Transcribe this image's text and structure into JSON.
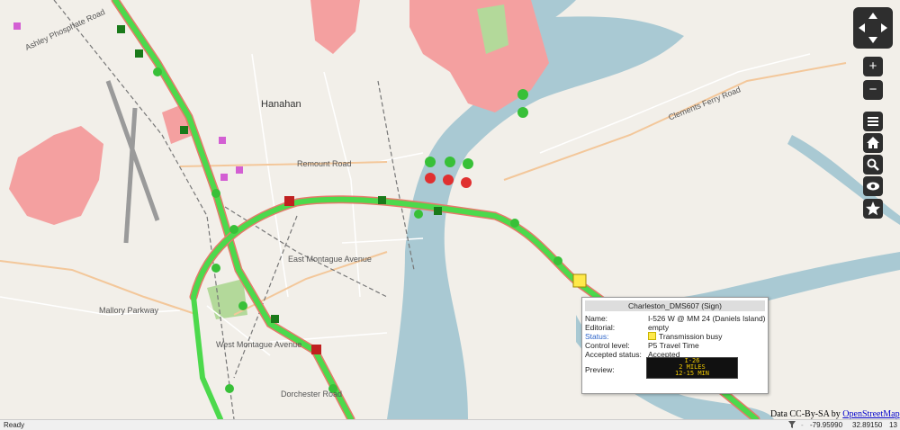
{
  "map": {
    "places": [
      {
        "id": "hanahan",
        "text": "Hanahan"
      },
      {
        "id": "remount",
        "text": "Remount Road"
      },
      {
        "id": "clements",
        "text": "Clements Ferry Road"
      },
      {
        "id": "montague",
        "text": "East Montague Avenue"
      },
      {
        "id": "westmontague",
        "text": "West Montague Avenue"
      },
      {
        "id": "dorchester",
        "text": "Dorchester Road"
      },
      {
        "id": "mallory",
        "text": "Mallory Parkway"
      },
      {
        "id": "ashley",
        "text": "Ashley Phosphate Road"
      }
    ],
    "colors": {
      "freeway": "#4cd94c",
      "incident": "#e03030",
      "zone": "#f4a0a0",
      "water": "#a9c9d3",
      "park": "#b3d99a"
    }
  },
  "controls": {
    "pan_icon": "pan-arrows-icon",
    "zoom_in": "+",
    "zoom_out": "−",
    "menu_icon": "menu-icon",
    "home_icon": "home-icon",
    "search_icon": "search-icon",
    "view_icon": "eye-icon",
    "favorite_icon": "star-icon"
  },
  "popup": {
    "title": "Charleston_DMS607 (Sign)",
    "name_label": "Name:",
    "name_value": "I-526 W @ MM 24 (Daniels Island)",
    "editorial_label": "Editorial:",
    "editorial_value": "empty",
    "status_label": "Status:",
    "status_value": "Transmission busy",
    "status_color": "#ffe94a",
    "control_label": "Control level:",
    "control_value": "P5 Travel Time",
    "accepted_label": "Accepted status:",
    "accepted_value": "Accepted",
    "preview_label": "Preview:",
    "preview_lines": [
      "I-26",
      "2 MILES",
      "12-15 MIN"
    ]
  },
  "attribution": {
    "text": "Data CC-By-SA by",
    "link": "OpenStreetMap"
  },
  "statusbar": {
    "ready": "Ready",
    "longitude": "-79.95990",
    "latitude": "32.89150",
    "zoom": "13"
  }
}
